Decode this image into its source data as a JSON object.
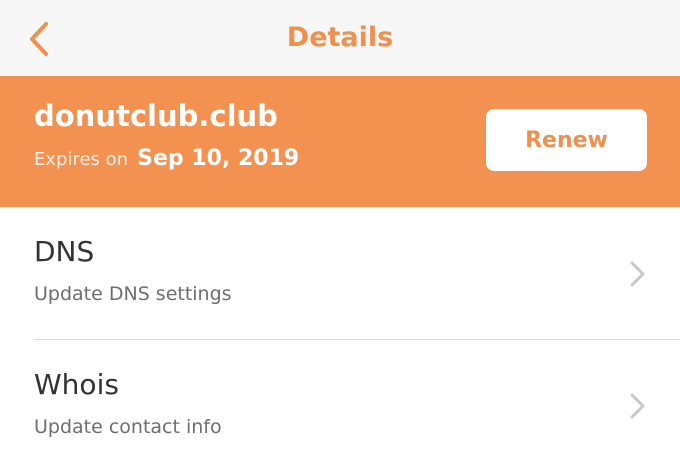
{
  "navbar": {
    "title": "Details",
    "back_icon": "chevron-left-icon"
  },
  "domain": {
    "name": "donutclub.club",
    "expiry_prefix": "Expires on",
    "expiry_date": "Sep 10, 2019",
    "renew_label": "Renew"
  },
  "rows": [
    {
      "title": "DNS",
      "subtitle": "Update DNS settings",
      "icon": "chevron-right-icon"
    },
    {
      "title": "Whois",
      "subtitle": "Update contact info",
      "icon": "chevron-right-icon"
    }
  ],
  "colors": {
    "accent": "#f0904f",
    "banner": "#f29150",
    "navbar_bg": "#f7f7f7",
    "chevron": "#c7c7cc"
  }
}
